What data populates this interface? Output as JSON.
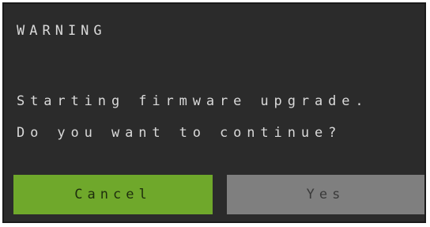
{
  "dialog": {
    "title": "WARNING",
    "message_lines": [
      "Starting firmware upgrade.",
      "Do you want to continue?"
    ],
    "buttons": {
      "cancel_label": "Cancel",
      "yes_label": "Yes"
    }
  },
  "colors": {
    "background": "#2b2b2b",
    "text": "#d9d9d9",
    "cancel_button": "#6fa82b",
    "yes_button": "#7f7f7f"
  }
}
